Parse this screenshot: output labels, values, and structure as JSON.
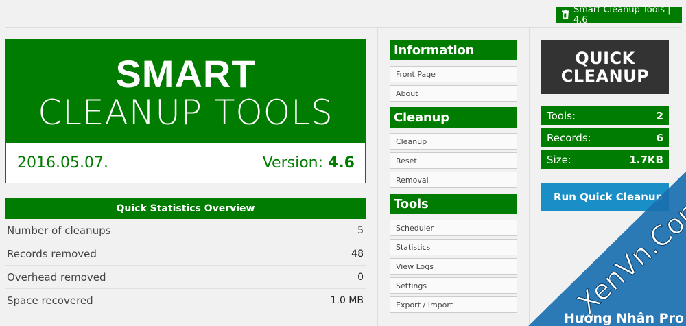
{
  "top_badge": "Smart Cleanup Tools | 4.6",
  "logo": {
    "line1": "SMART",
    "line2": "CLEANUP TOOLS",
    "date": "2016.05.07.",
    "version_label": "Version:",
    "version_value": "4.6"
  },
  "stats": {
    "title": "Quick Statistics Overview",
    "rows": [
      {
        "label": "Number of cleanups",
        "value": "5"
      },
      {
        "label": "Records removed",
        "value": "48"
      },
      {
        "label": "Overhead removed",
        "value": "0"
      },
      {
        "label": "Space recovered",
        "value": "1.0 MB"
      }
    ]
  },
  "menu": {
    "information": {
      "title": "Information",
      "items": [
        "Front Page",
        "About"
      ]
    },
    "cleanup": {
      "title": "Cleanup",
      "items": [
        "Cleanup",
        "Reset",
        "Removal"
      ]
    },
    "tools": {
      "title": "Tools",
      "items": [
        "Scheduler",
        "Statistics",
        "View Logs",
        "Settings",
        "Export / Import"
      ]
    }
  },
  "quick_cleanup": {
    "line1": "QUICK",
    "line2": "CLEANUP"
  },
  "info": [
    {
      "label": "Tools:",
      "value": "2"
    },
    {
      "label": "Records:",
      "value": "6"
    },
    {
      "label": "Size:",
      "value": "1.7KB"
    }
  ],
  "run_button": "Run Quick Cleanup",
  "watermark": {
    "site": "XenVn.Com",
    "tagline": "Hướng Nhân Pro"
  },
  "colors": {
    "brand_green": "#007c00",
    "dark": "#333333",
    "blue": "#1a8ec7"
  }
}
